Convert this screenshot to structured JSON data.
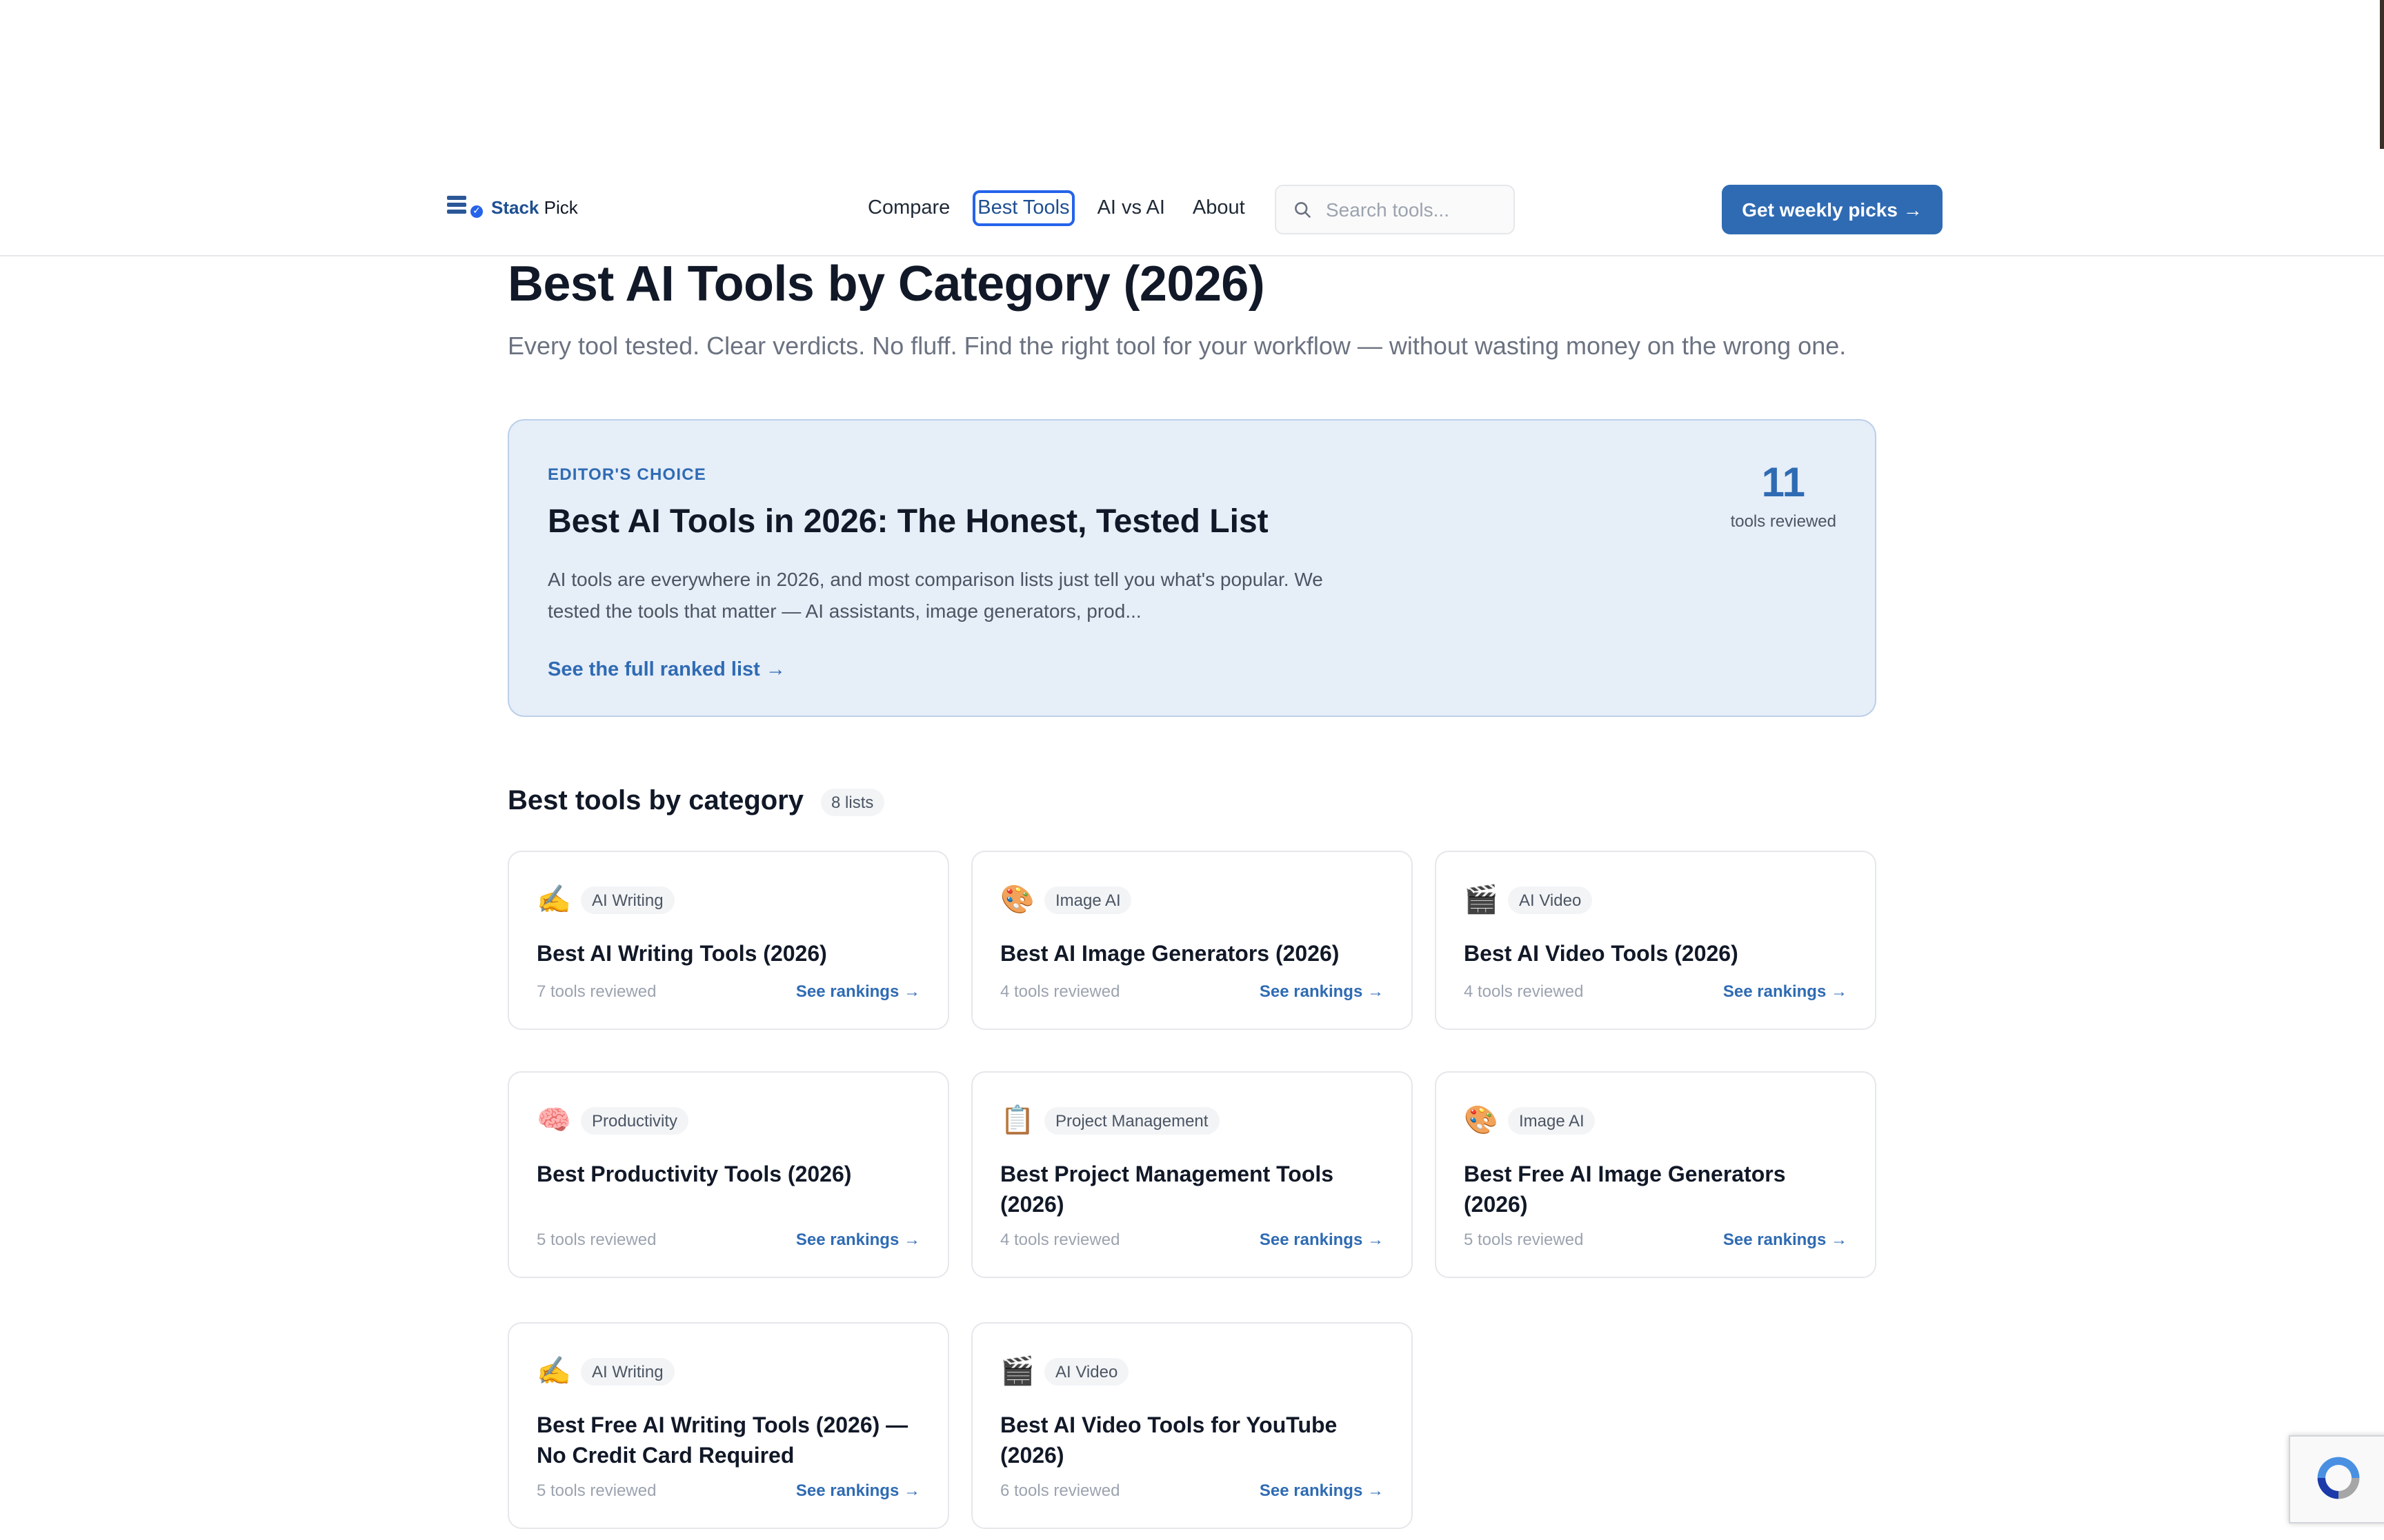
{
  "header": {
    "logo": {
      "brand": "Stack",
      "suffix": "Pick"
    },
    "nav": [
      {
        "label": "Compare"
      },
      {
        "label": "Best Tools",
        "active": true
      },
      {
        "label": "AI vs AI"
      },
      {
        "label": "About"
      }
    ],
    "search": {
      "placeholder": "Search tools...",
      "value": ""
    },
    "cta_label": "Get weekly picks →"
  },
  "hero": {
    "title": "Best AI Tools by Category (2026)",
    "subtitle": "Every tool tested. Clear verdicts. No fluff. Find the right tool for your workflow — without wasting money on the wrong one."
  },
  "featured": {
    "kicker": "EDITOR'S CHOICE",
    "title": "Best AI Tools in 2026: The Honest, Tested List",
    "description": "AI tools are everywhere in 2026, and most comparison lists just tell you what's popular. We tested the tools that matter — AI assistants, image generators, prod...",
    "link": "See the full ranked list →",
    "count": "11",
    "count_label": "tools reviewed"
  },
  "section": {
    "title": "Best tools by category",
    "count_label": "8 lists"
  },
  "cards": [
    {
      "emoji": "✍️",
      "icon": "writing-hand-icon",
      "tag": "AI Writing",
      "title": "Best AI Writing Tools (2026)",
      "reviewed": "7 tools reviewed",
      "link": "See rankings →"
    },
    {
      "emoji": "🎨",
      "icon": "palette-icon",
      "tag": "Image AI",
      "title": "Best AI Image Generators (2026)",
      "reviewed": "4 tools reviewed",
      "link": "See rankings →"
    },
    {
      "emoji": "🎬",
      "icon": "clapper-icon",
      "tag": "AI Video",
      "title": "Best AI Video Tools (2026)",
      "reviewed": "4 tools reviewed",
      "link": "See rankings →"
    },
    {
      "emoji": "🧠",
      "icon": "brain-icon",
      "tag": "Productivity",
      "title": "Best Productivity Tools (2026)",
      "reviewed": "5 tools reviewed",
      "link": "See rankings →"
    },
    {
      "emoji": "📋",
      "icon": "clipboard-icon",
      "tag": "Project Management",
      "title": "Best Project Management Tools (2026)",
      "reviewed": "4 tools reviewed",
      "link": "See rankings →"
    },
    {
      "emoji": "🎨",
      "icon": "palette-icon",
      "tag": "Image AI",
      "title": "Best Free AI Image Generators (2026)",
      "reviewed": "5 tools reviewed",
      "link": "See rankings →"
    },
    {
      "emoji": "✍️",
      "icon": "writing-hand-icon",
      "tag": "AI Writing",
      "title": "Best Free AI Writing Tools (2026) — No Credit Card Required",
      "reviewed": "5 tools reviewed",
      "link": "See rankings →"
    },
    {
      "emoji": "🎬",
      "icon": "clapper-icon",
      "tag": "AI Video",
      "title": "Best AI Video Tools for YouTube (2026)",
      "reviewed": "6 tools reviewed",
      "link": "See rankings →"
    }
  ],
  "colors": {
    "accent": "#2f6bb3",
    "featured_bg": "#e6eef8",
    "text": "#111827",
    "muted": "#6b7280"
  }
}
